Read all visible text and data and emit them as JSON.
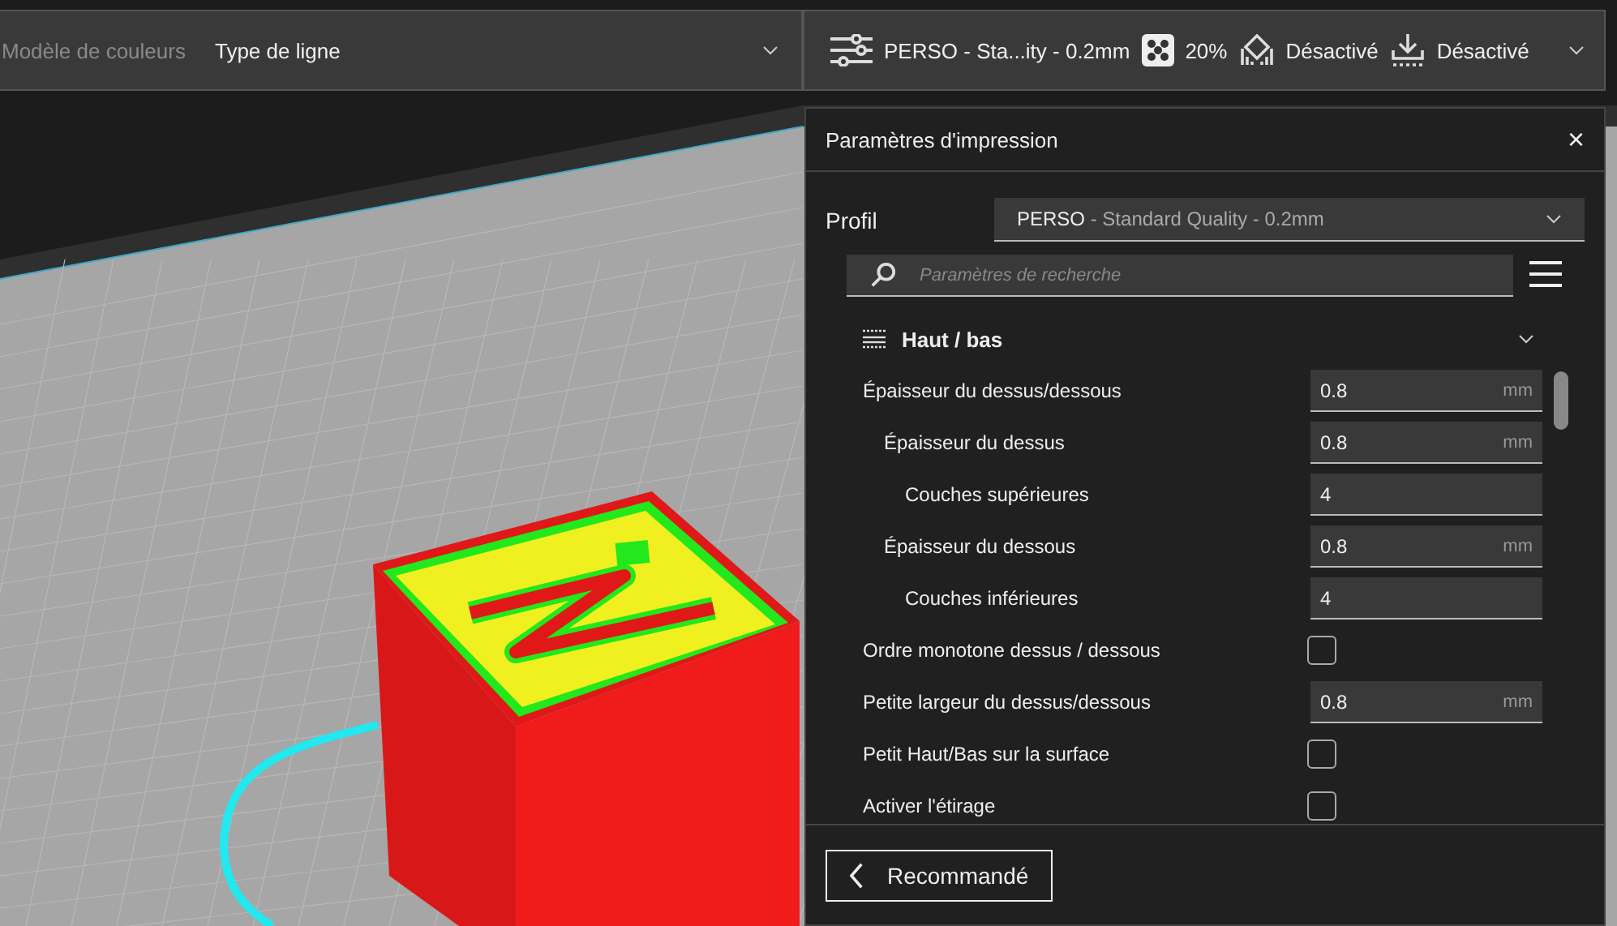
{
  "color_scheme": {
    "label": "Modèle de couleurs",
    "value": "Type de ligne"
  },
  "print_summary": {
    "profile": "PERSO - Sta...ity - 0.2mm",
    "infill": "20%",
    "support": "Désactivé",
    "adhesion": "Désactivé"
  },
  "print_settings": {
    "title": "Paramètres d'impression",
    "close": "×",
    "profile_label": "Profil",
    "profile_name": "PERSO",
    "profile_detail": " - Standard Quality - 0.2mm",
    "search": {
      "placeholder": "Paramètres de recherche"
    },
    "section": {
      "title": "Haut / bas",
      "expanded": true
    },
    "settings": [
      {
        "kind": "number",
        "label": "Épaisseur du dessus/dessous",
        "value": "0.8",
        "unit": "mm",
        "children": [
          {
            "kind": "number",
            "label": "Épaisseur du dessus",
            "value": "0.8",
            "unit": "mm",
            "children": [
              {
                "kind": "number",
                "label": "Couches supérieures",
                "value": "4"
              }
            ]
          },
          {
            "kind": "number",
            "label": "Épaisseur du dessous",
            "value": "0.8",
            "unit": "mm",
            "children": [
              {
                "kind": "number",
                "label": "Couches inférieures",
                "value": "4"
              }
            ]
          }
        ]
      },
      {
        "kind": "checkbox",
        "label": "Ordre monotone dessus / dessous",
        "checked": false
      },
      {
        "kind": "number",
        "label": "Petite largeur du dessus/dessous",
        "value": "0.8",
        "unit": "mm"
      },
      {
        "kind": "checkbox",
        "label": "Petit Haut/Bas sur la surface",
        "checked": false
      },
      {
        "kind": "checkbox",
        "label": "Activer l'étirage",
        "checked": false
      }
    ],
    "footer_button": "Recommandé"
  }
}
